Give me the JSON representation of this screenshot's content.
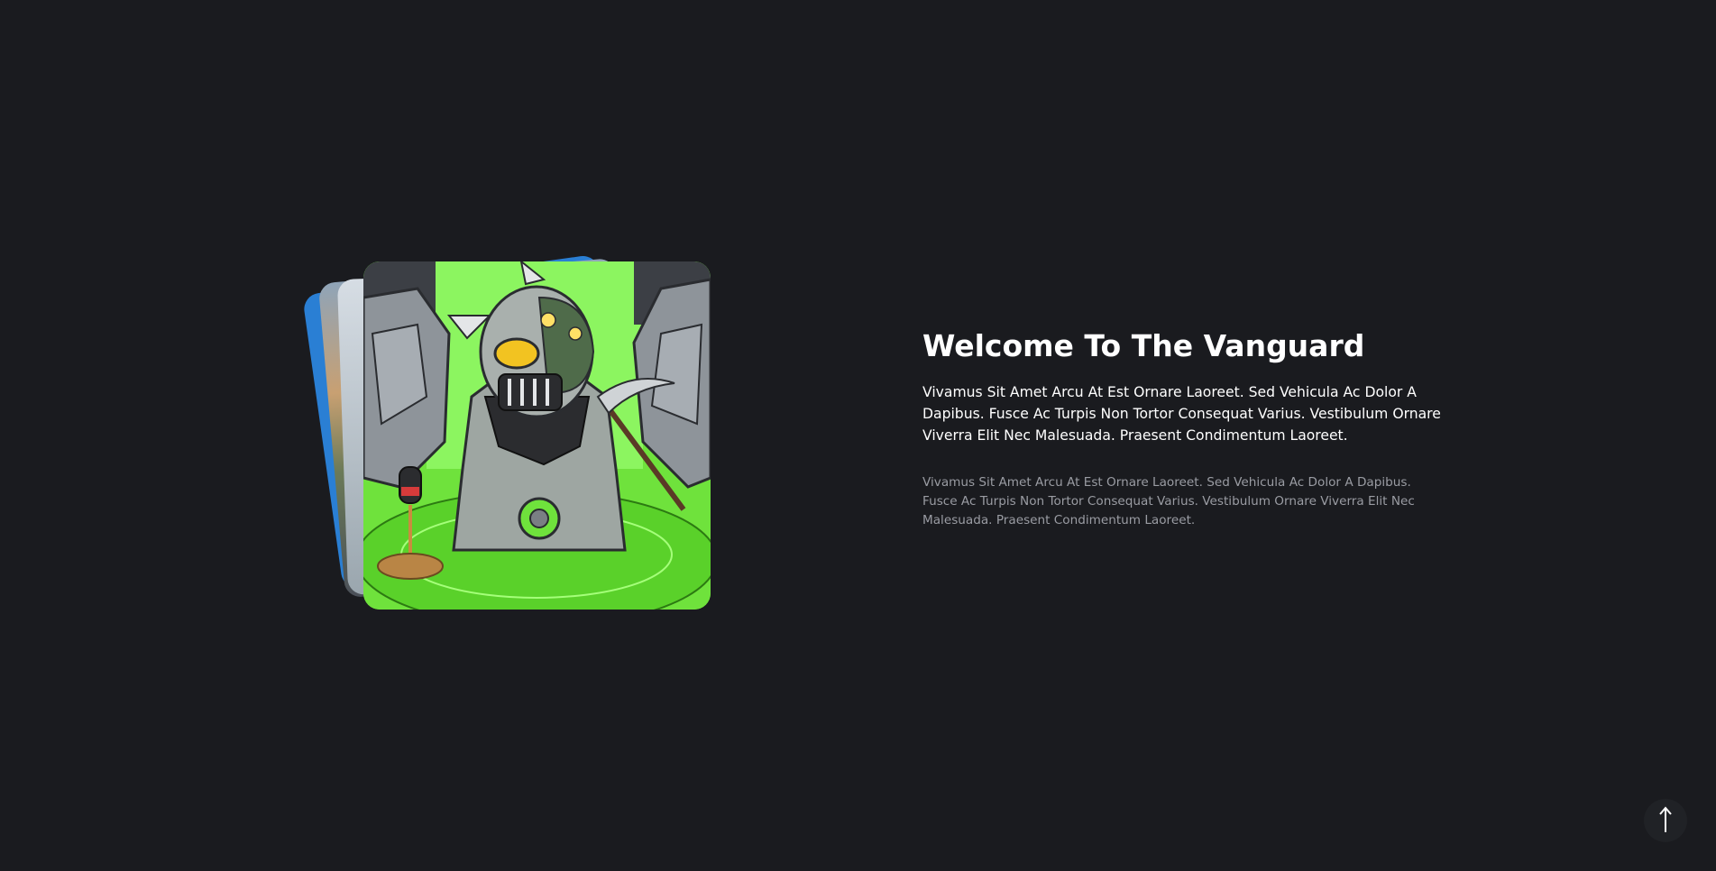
{
  "hero": {
    "title": "Welcome To The Vanguard",
    "lead": "Vivamus Sit Amet Arcu At Est Ornare Laoreet. Sed Vehicula Ac Dolor A Dapibus. Fusce Ac Turpis Non Tortor Consequat Varius. Vestibulum Ornare Viverra Elit Nec Malesuada. Praesent Condimentum Laoreet.",
    "body": "Vivamus Sit Amet Arcu At Est Ornare Laoreet. Sed Vehicula Ac Dolor A Dapibus. Fusce Ac Turpis Non Tortor Consequat Varius. Vestibulum Ornare Viverra Elit Nec Malesuada. Praesent Condimentum Laoreet."
  },
  "scroll_top": {
    "icon": "arrow-up-icon"
  },
  "colors": {
    "background": "#1a1b1f",
    "title": "#ffffff",
    "muted_text": "#9a9ca3",
    "slime_green": "#70e040"
  }
}
